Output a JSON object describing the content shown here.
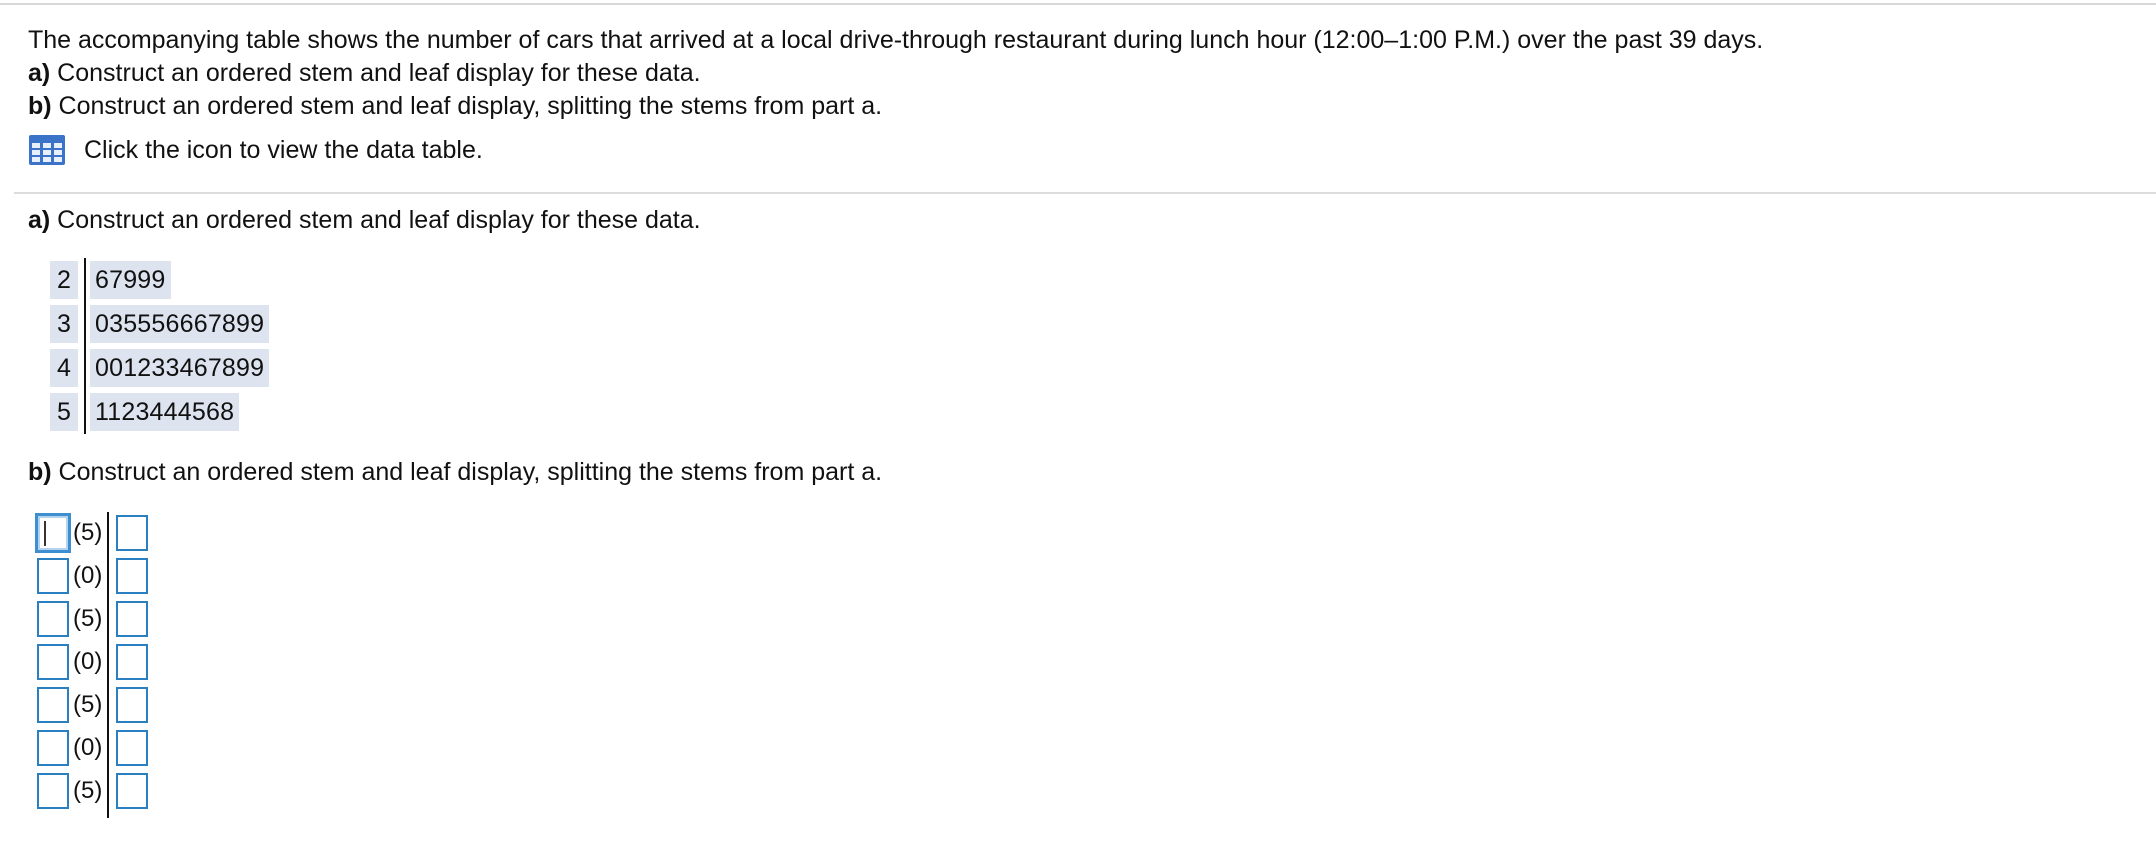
{
  "problem": {
    "intro": "The accompanying table shows the number of cars that arrived at a local drive-through restaurant during lunch hour (12:00–1:00 P.M.) over the past 39 days.",
    "part_a_label": "a)",
    "part_a_text": " Construct an ordered stem and leaf display for these data.",
    "part_b_label": "b)",
    "part_b_text": " Construct an ordered stem and leaf display, splitting the stems from part a.",
    "data_link_text": "Click the icon to view the data table."
  },
  "part_a": {
    "label": "a)",
    "title": " Construct an ordered stem and leaf display for these data.",
    "rows": [
      {
        "stem": "2",
        "leaves": "67999"
      },
      {
        "stem": "3",
        "leaves": "035556667899"
      },
      {
        "stem": "4",
        "leaves": "001233467899"
      },
      {
        "stem": "5",
        "leaves": "1123444568"
      }
    ]
  },
  "part_b": {
    "label": "b)",
    "title": " Construct an ordered stem and leaf display, splitting the stems from part a.",
    "rows": [
      {
        "split": "(5)",
        "stem_value": "",
        "leaf_value": ""
      },
      {
        "split": "(0)",
        "stem_value": "",
        "leaf_value": ""
      },
      {
        "split": "(5)",
        "stem_value": "",
        "leaf_value": ""
      },
      {
        "split": "(0)",
        "stem_value": "",
        "leaf_value": ""
      },
      {
        "split": "(5)",
        "stem_value": "",
        "leaf_value": ""
      },
      {
        "split": "(0)",
        "stem_value": "",
        "leaf_value": ""
      },
      {
        "split": "(5)",
        "stem_value": "",
        "leaf_value": ""
      }
    ]
  },
  "icons": {
    "data_table": "table-grid-icon"
  },
  "colors": {
    "answer_highlight": "#dde3ef",
    "input_border": "#2a7fc1",
    "icon_blue": "#3b73c8"
  }
}
